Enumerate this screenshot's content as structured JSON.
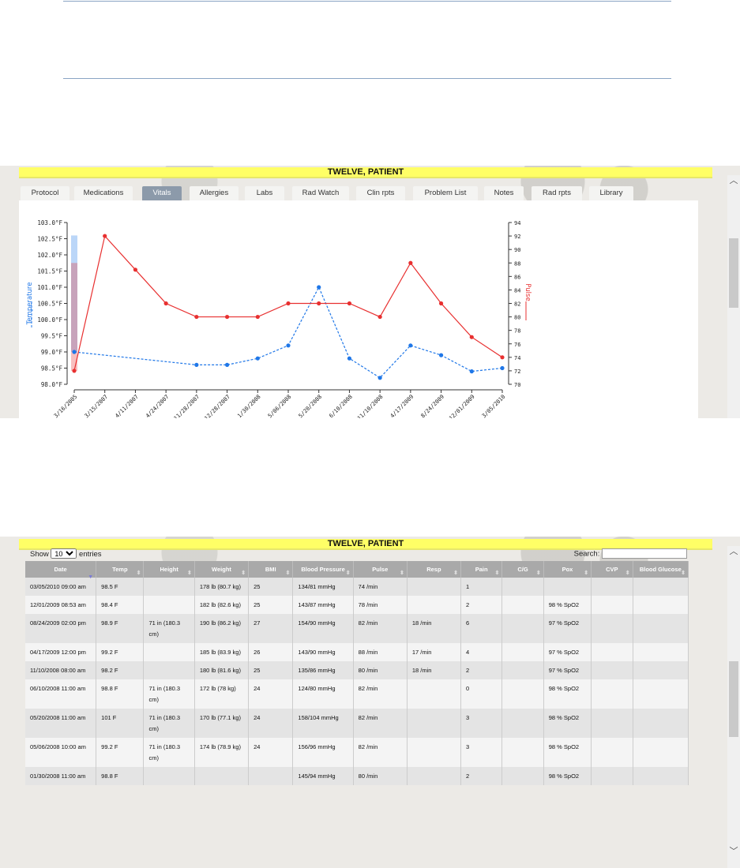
{
  "patient_name": "TWELVE, PATIENT",
  "tabs": [
    {
      "label": "Protocol",
      "active": false
    },
    {
      "label": "Medications",
      "active": false
    },
    {
      "label": "Vitals",
      "active": true
    },
    {
      "label": "Allergies",
      "active": false
    },
    {
      "label": "Labs",
      "active": false
    },
    {
      "label": "Rad Watch",
      "active": false
    },
    {
      "label": "Clin rpts",
      "active": false
    },
    {
      "label": "Problem List",
      "active": false
    },
    {
      "label": "Notes",
      "active": false
    },
    {
      "label": "Rad rpts",
      "active": false
    },
    {
      "label": "Library",
      "active": false
    }
  ],
  "chart_data": {
    "type": "line",
    "title": "",
    "x": [
      "3/16/2005",
      "3/15/2007",
      "4/11/2007",
      "4/24/2007",
      "11/28/2007",
      "12/28/2007",
      "1/30/2008",
      "5/06/2008",
      "5/20/2008",
      "6/10/2008",
      "11/10/2008",
      "4/17/2009",
      "8/24/2009",
      "12/01/2009",
      "3/05/2010"
    ],
    "series": [
      {
        "name": "Temperature",
        "axis": "left",
        "style": "dashed",
        "color": "#1f77e8",
        "values": [
          99.0,
          null,
          null,
          null,
          98.6,
          98.6,
          98.8,
          99.2,
          101.0,
          98.8,
          98.2,
          99.2,
          98.9,
          98.4,
          98.5
        ]
      },
      {
        "name": "Pulse",
        "axis": "right",
        "style": "solid",
        "color": "#e83030",
        "values": [
          72,
          92,
          87,
          82,
          80,
          80,
          80,
          82,
          82,
          82,
          80,
          88,
          82,
          77,
          74
        ]
      }
    ],
    "left_axis": {
      "label": "Temperature",
      "ylim": [
        98.0,
        103.0
      ],
      "ticks": [
        "98.0°F",
        "98.5°F",
        "99.0°F",
        "99.5°F",
        "100.0°F",
        "100.5°F",
        "101.0°F",
        "101.5°F",
        "102.0°F",
        "102.5°F",
        "103.0°F"
      ]
    },
    "right_axis": {
      "label": "Pulse",
      "ylim": [
        70,
        94
      ],
      "ticks": [
        "70",
        "72",
        "74",
        "76",
        "78",
        "80",
        "82",
        "84",
        "86",
        "88",
        "90",
        "92",
        "94"
      ]
    },
    "highlight": {
      "temperature_range": [
        99.0,
        102.6
      ],
      "pulse_range": [
        72,
        88
      ]
    }
  },
  "table": {
    "show_label": "Show",
    "entries_label": "entries",
    "page_size": "10",
    "search_label": "Search:",
    "search_value": "",
    "columns": [
      "Date",
      "Temp",
      "Height",
      "Weight",
      "BMI",
      "Blood Pressure",
      "Pulse",
      "Resp",
      "Pain",
      "C/G",
      "Pox",
      "CVP",
      "Blood Glucose"
    ],
    "rows": [
      [
        "03/05/2010 09:00 am",
        "98.5 F",
        "",
        "178 lb (80.7 kg)",
        "25",
        "134/81 mmHg",
        "74 /min",
        "",
        "1",
        "",
        "",
        "",
        ""
      ],
      [
        "12/01/2009 08:53 am",
        "98.4 F",
        "",
        "182 lb (82.6 kg)",
        "25",
        "143/87 mmHg",
        "78 /min",
        "",
        "2",
        "",
        "98 % SpO2",
        "",
        ""
      ],
      [
        "08/24/2009 02:00 pm",
        "98.9 F",
        "71 in (180.3 cm)",
        "190 lb (86.2 kg)",
        "27",
        "154/90 mmHg",
        "82 /min",
        "18 /min",
        "6",
        "",
        "97 % SpO2",
        "",
        ""
      ],
      [
        "04/17/2009 12:00 pm",
        "99.2 F",
        "",
        "185 lb (83.9 kg)",
        "26",
        "143/90 mmHg",
        "88 /min",
        "17 /min",
        "4",
        "",
        "97 % SpO2",
        "",
        ""
      ],
      [
        "11/10/2008 08:00 am",
        "98.2 F",
        "",
        "180 lb (81.6 kg)",
        "25",
        "135/86 mmHg",
        "80 /min",
        "18 /min",
        "2",
        "",
        "97 % SpO2",
        "",
        ""
      ],
      [
        "06/10/2008 11:00 am",
        "98.8 F",
        "71 in (180.3 cm)",
        "172 lb (78 kg)",
        "24",
        "124/80 mmHg",
        "82 /min",
        "",
        "0",
        "",
        "98 % SpO2",
        "",
        ""
      ],
      [
        "05/20/2008 11:00 am",
        "101 F",
        "71 in (180.3 cm)",
        "170 lb (77.1 kg)",
        "24",
        "158/104 mmHg",
        "82 /min",
        "",
        "3",
        "",
        "98 % SpO2",
        "",
        ""
      ],
      [
        "05/06/2008 10:00 am",
        "99.2 F",
        "71 in (180.3 cm)",
        "174 lb (78.9 kg)",
        "24",
        "156/96 mmHg",
        "82 /min",
        "",
        "3",
        "",
        "98 % SpO2",
        "",
        ""
      ],
      [
        "01/30/2008 11:00 am",
        "98.8 F",
        "",
        "",
        "",
        "145/94 mmHg",
        "80 /min",
        "",
        "2",
        "",
        "98 % SpO2",
        "",
        ""
      ]
    ]
  }
}
